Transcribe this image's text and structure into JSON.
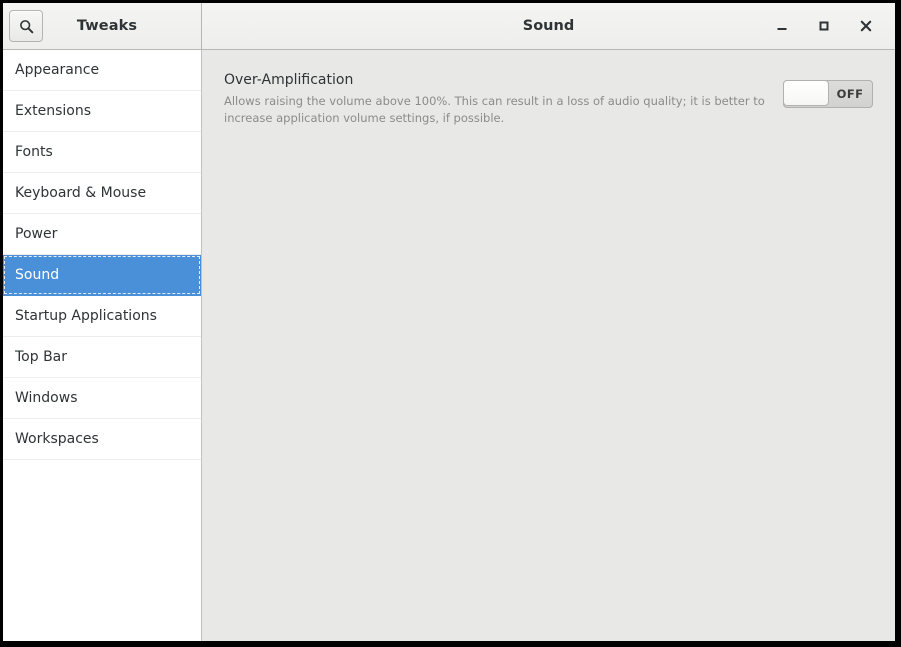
{
  "window": {
    "sidebar_header_title": "Tweaks",
    "main_header_title": "Sound",
    "search_icon": "search-icon",
    "controls": {
      "minimize": "_",
      "maximize": "□",
      "close": "✕"
    },
    "accent_color": "#4a90d9",
    "sidebar_bg": "#ffffff",
    "content_bg": "#e8e8e7",
    "header_bg": "#f1f1ef"
  },
  "sidebar": {
    "items": [
      {
        "label": "Appearance",
        "selected": false
      },
      {
        "label": "Extensions",
        "selected": false
      },
      {
        "label": "Fonts",
        "selected": false
      },
      {
        "label": "Keyboard & Mouse",
        "selected": false
      },
      {
        "label": "Power",
        "selected": false
      },
      {
        "label": "Sound",
        "selected": true
      },
      {
        "label": "Startup Applications",
        "selected": false
      },
      {
        "label": "Top Bar",
        "selected": false
      },
      {
        "label": "Windows",
        "selected": false
      },
      {
        "label": "Workspaces",
        "selected": false
      }
    ]
  },
  "content": {
    "settings": [
      {
        "title": "Over-Amplification",
        "description": "Allows raising the volume above 100%. This can result in a loss of audio quality; it is better to increase application volume settings, if possible.",
        "switch_state": "OFF"
      }
    ]
  }
}
